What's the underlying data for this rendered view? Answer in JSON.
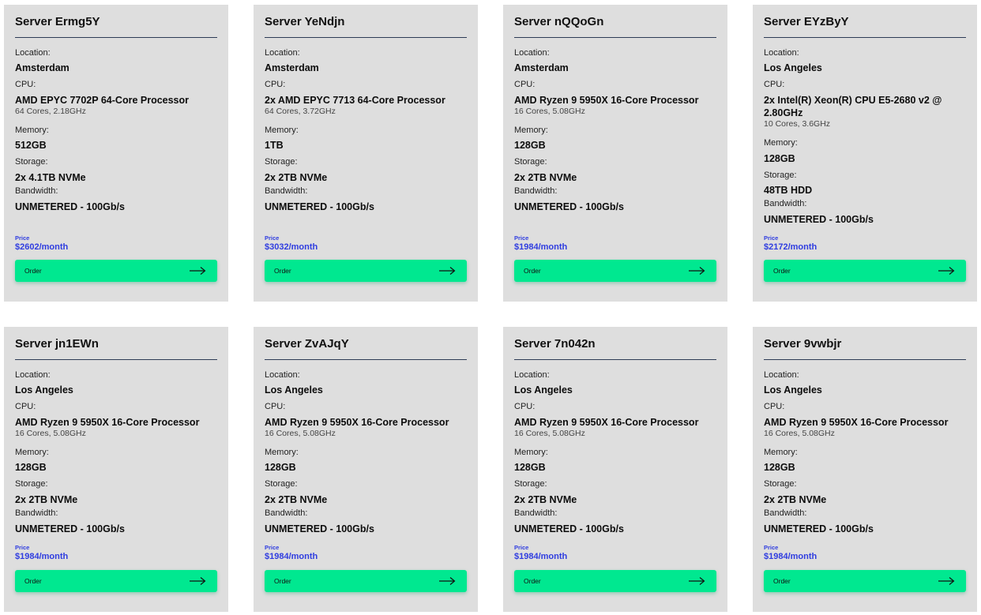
{
  "labels": {
    "location": "Location:",
    "cpu": "CPU:",
    "memory": "Memory:",
    "storage": "Storage:",
    "bandwidth": "Bandwidth:",
    "price": "Price",
    "order": "Order"
  },
  "icons": {
    "order_arrow": "arrow-right-icon"
  },
  "colors": {
    "card_background": "#dedede",
    "order_button": "#00e890",
    "price_text": "#2f3de0",
    "title_rule": "#2d3b55"
  },
  "servers": [
    {
      "name": "Server Ermg5Y",
      "location": "Amsterdam",
      "cpu": "AMD EPYC 7702P 64-Core Processor",
      "cpu_detail": "64 Cores, 2.18GHz",
      "memory": "512GB",
      "storage": "2x 4.1TB NVMe",
      "bandwidth": "UNMETERED - 100Gb/s",
      "price": "$2602/month"
    },
    {
      "name": "Server YeNdjn",
      "location": "Amsterdam",
      "cpu": "2x AMD EPYC 7713 64-Core Processor",
      "cpu_detail": "64 Cores, 3.72GHz",
      "memory": "1TB",
      "storage": "2x 2TB NVMe",
      "bandwidth": "UNMETERED - 100Gb/s",
      "price": "$3032/month"
    },
    {
      "name": "Server nQQoGn",
      "location": "Amsterdam",
      "cpu": "AMD Ryzen 9 5950X 16-Core Processor",
      "cpu_detail": "16 Cores, 5.08GHz",
      "memory": "128GB",
      "storage": "2x 2TB NVMe",
      "bandwidth": "UNMETERED - 100Gb/s",
      "price": "$1984/month"
    },
    {
      "name": "Server EYzByY",
      "location": "Los Angeles",
      "cpu": "2x Intel(R) Xeon(R) CPU E5-2680 v2 @ 2.80GHz",
      "cpu_detail": "10 Cores, 3.6GHz",
      "memory": "128GB",
      "storage": "48TB HDD",
      "bandwidth": "UNMETERED - 100Gb/s",
      "price": "$2172/month"
    },
    {
      "name": "Server jn1EWn",
      "location": "Los Angeles",
      "cpu": "AMD Ryzen 9 5950X 16-Core Processor",
      "cpu_detail": "16 Cores, 5.08GHz",
      "memory": "128GB",
      "storage": "2x 2TB NVMe",
      "bandwidth": "UNMETERED - 100Gb/s",
      "price": "$1984/month"
    },
    {
      "name": "Server ZvAJqY",
      "location": "Los Angeles",
      "cpu": "AMD Ryzen 9 5950X 16-Core Processor",
      "cpu_detail": "16 Cores, 5.08GHz",
      "memory": "128GB",
      "storage": "2x 2TB NVMe",
      "bandwidth": "UNMETERED - 100Gb/s",
      "price": "$1984/month"
    },
    {
      "name": "Server 7n042n",
      "location": "Los Angeles",
      "cpu": "AMD Ryzen 9 5950X 16-Core Processor",
      "cpu_detail": "16 Cores, 5.08GHz",
      "memory": "128GB",
      "storage": "2x 2TB NVMe",
      "bandwidth": "UNMETERED - 100Gb/s",
      "price": "$1984/month"
    },
    {
      "name": "Server 9vwbjr",
      "location": "Los Angeles",
      "cpu": "AMD Ryzen 9 5950X 16-Core Processor",
      "cpu_detail": "16 Cores, 5.08GHz",
      "memory": "128GB",
      "storage": "2x 2TB NVMe",
      "bandwidth": "UNMETERED - 100Gb/s",
      "price": "$1984/month"
    }
  ]
}
